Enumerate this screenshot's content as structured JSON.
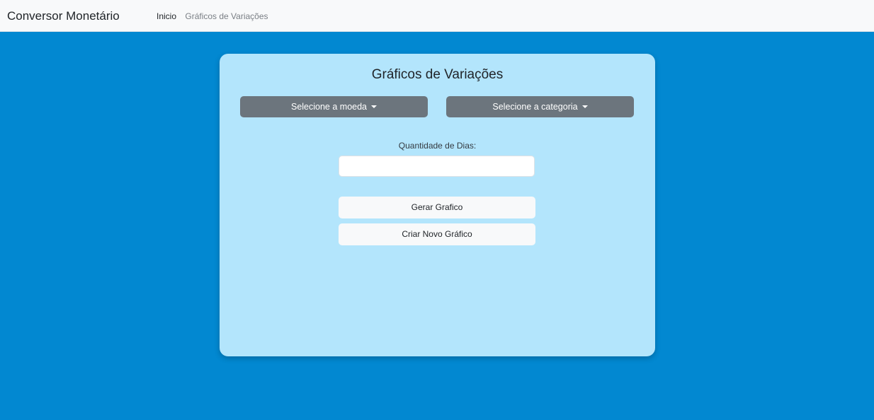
{
  "navbar": {
    "brand": "Conversor Monetário",
    "links": [
      {
        "label": "Inicio",
        "active": true
      },
      {
        "label": "Gráficos de Variações",
        "active": false
      }
    ]
  },
  "card": {
    "title": "Gráficos de Variações",
    "currency_dropdown": {
      "label": "Selecione a moeda",
      "icon": "caret-down-icon"
    },
    "category_dropdown": {
      "label": "Selecione a categoria",
      "icon": "caret-down-icon"
    },
    "days_field": {
      "label": "Quantidade de Dias:",
      "value": "",
      "placeholder": ""
    },
    "generate_button": "Gerar Grafico",
    "new_chart_button": "Criar Novo Gráfico"
  },
  "colors": {
    "page_background": "#0288d1",
    "navbar_background": "#f8f9fa",
    "card_background": "#b3e5fc",
    "dropdown_background": "#6c757d",
    "button_light": "#f8f9fa"
  }
}
